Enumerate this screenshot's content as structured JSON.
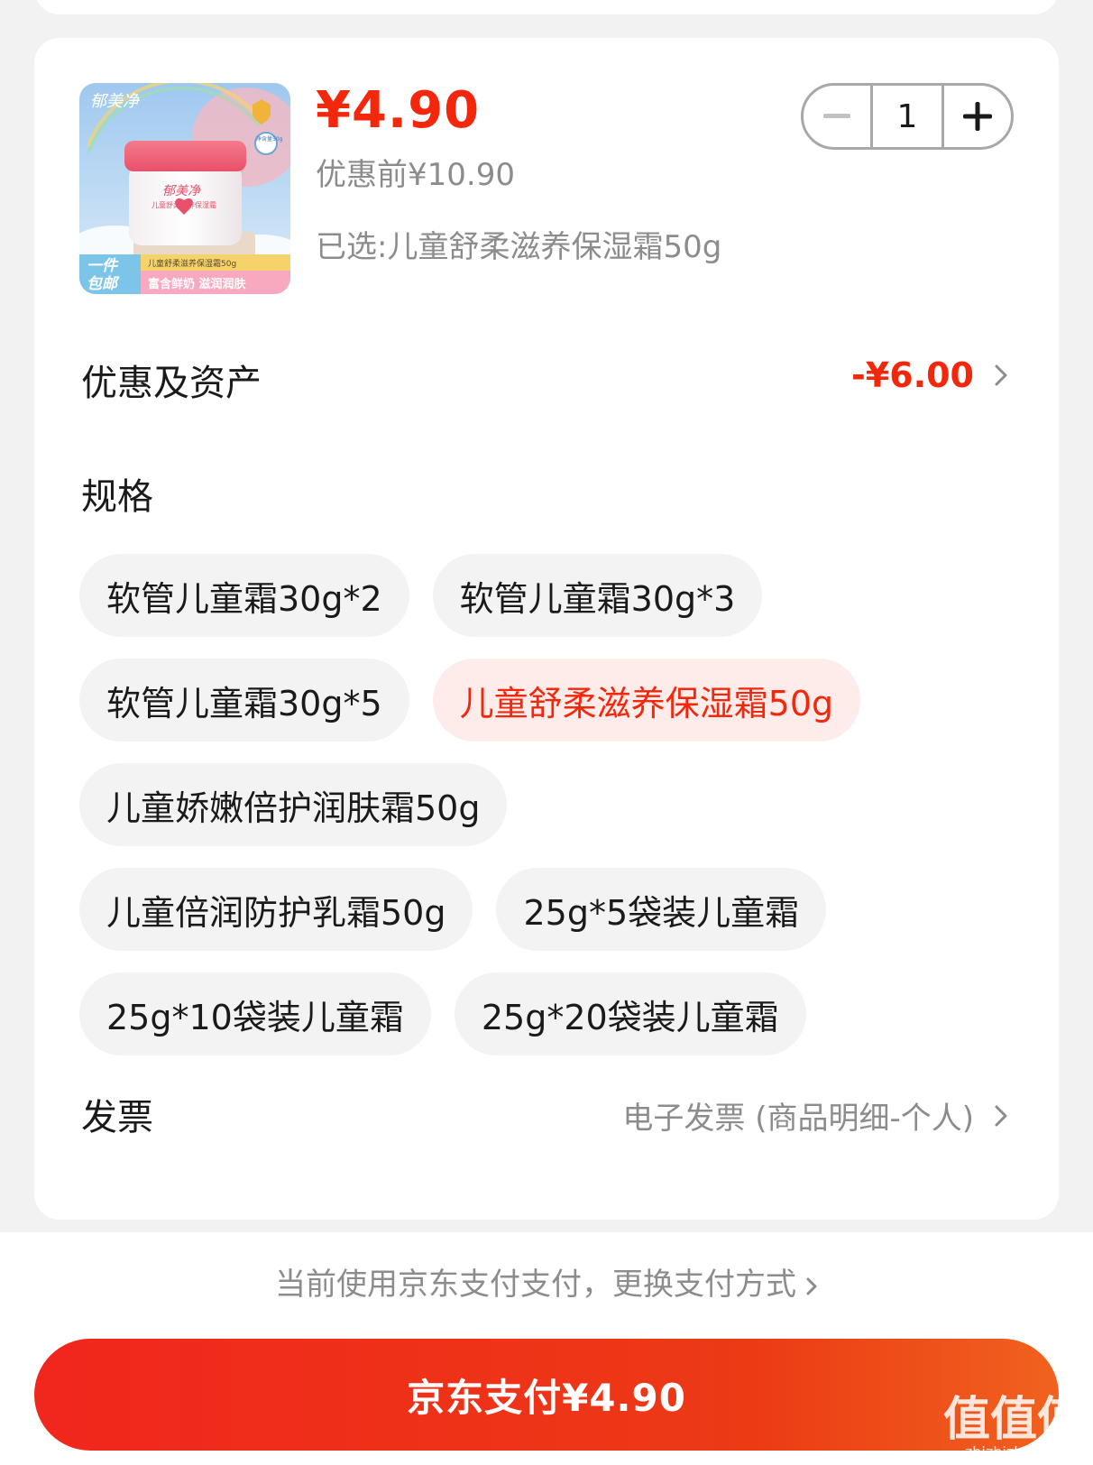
{
  "product": {
    "price": "¥4.90",
    "original_price": "优惠前¥10.90",
    "selected_spec": "已选:儿童舒柔滋养保湿霜50g",
    "quantity": "1",
    "thumbnail": {
      "brand": "郁美净",
      "product_name": "儿童舒柔滋养保湿霜",
      "net_weight": "净含量50g",
      "badge_line1": "一件",
      "badge_line2": "包邮",
      "banner_top": "儿童舒柔滋养保湿霜50g",
      "banner_bottom": "富含鲜奶 滋润润肤"
    }
  },
  "discount": {
    "label": "优惠及资产",
    "value": "-¥6.00"
  },
  "spec": {
    "label": "规格",
    "options": [
      {
        "label": "软管儿童霜30g*2",
        "selected": false
      },
      {
        "label": "软管儿童霜30g*3",
        "selected": false
      },
      {
        "label": "软管儿童霜30g*5",
        "selected": false
      },
      {
        "label": "儿童舒柔滋养保湿霜50g",
        "selected": true
      },
      {
        "label": "儿童娇嫩倍护润肤霜50g",
        "selected": false
      },
      {
        "label": "儿童倍润防护乳霜50g",
        "selected": false
      },
      {
        "label": "25g*5袋装儿童霜",
        "selected": false
      },
      {
        "label": "25g*10袋装儿童霜",
        "selected": false
      },
      {
        "label": "25g*20袋装儿童霜",
        "selected": false
      }
    ]
  },
  "invoice": {
    "label": "发票",
    "value": "电子发票 (商品明细-个人)"
  },
  "payment": {
    "hint": "当前使用京东支付支付，更换支付方式",
    "button_label": "京东支付¥4.90"
  },
  "watermark": {
    "main": "值值值",
    "sub": "zhizhizhi.com"
  },
  "colors": {
    "accent": "#f2270c",
    "selected_chip_bg": "#fdecea",
    "chip_bg": "#f3f3f3",
    "page_bg": "#f2f2f2"
  }
}
